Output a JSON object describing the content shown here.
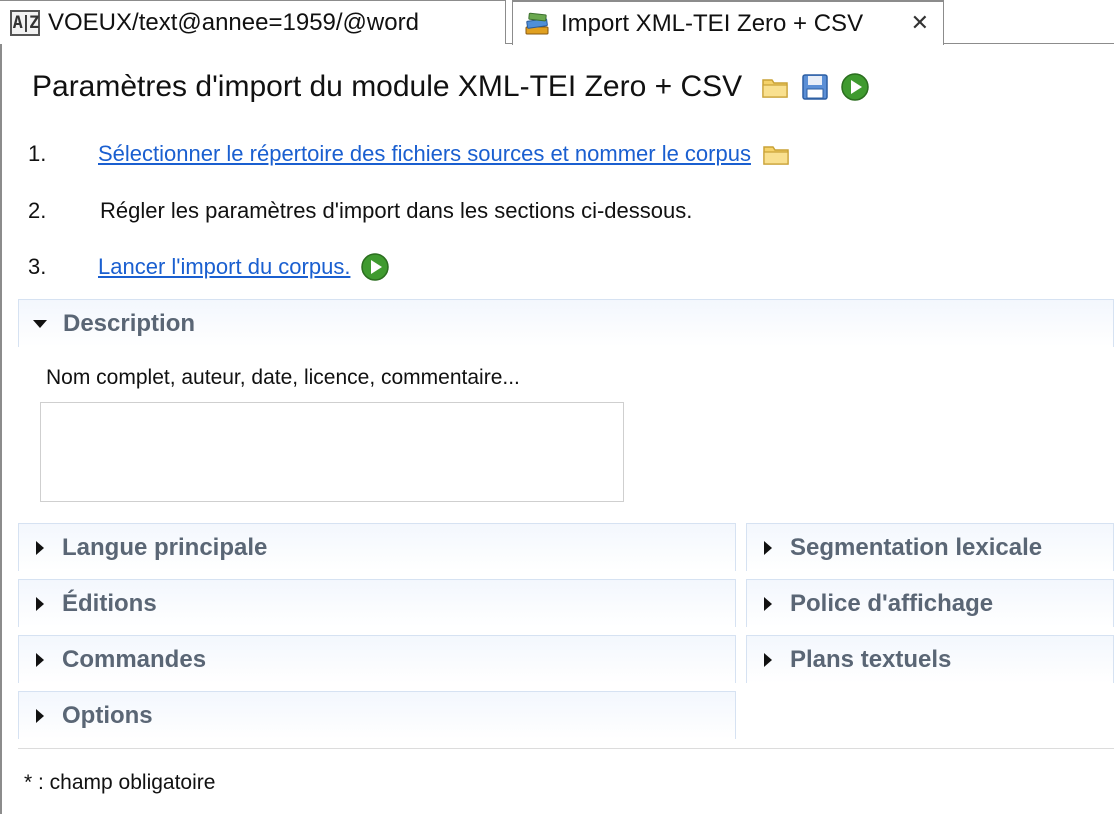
{
  "tabs": [
    {
      "label": "VOEUX/text@annee=1959/@word",
      "icon": "az-index-icon",
      "icon_text": "A|Z"
    },
    {
      "label": "Import XML-TEI Zero + CSV",
      "icon": "books-icon",
      "close": "✕"
    }
  ],
  "header": {
    "title": "Paramètres d'import du module XML-TEI Zero + CSV",
    "icons": [
      "folder-icon",
      "save-icon",
      "run-icon"
    ]
  },
  "steps": [
    {
      "num": "1.",
      "text": "Sélectionner le répertoire des fichiers sources et nommer le corpus",
      "link": true,
      "icon": "folder-icon"
    },
    {
      "num": "2.",
      "text": "Régler les paramètres d'import dans les sections ci-dessous.",
      "link": false
    },
    {
      "num": "3.",
      "text": "Lancer l'import du corpus.",
      "link": true,
      "icon": "run-icon"
    }
  ],
  "description": {
    "title": "Description",
    "expanded": true,
    "field_label": "Nom complet, auteur, date, licence, commentaire...",
    "value": ""
  },
  "sections_left": [
    "Langue principale",
    "Éditions",
    "Commandes",
    "Options"
  ],
  "sections_right": [
    "Segmentation lexicale",
    "Police d'affichage",
    "Plans textuels"
  ],
  "footer": {
    "note": "* : champ obligatoire"
  },
  "colors": {
    "link": "#1a5fd0",
    "section_text": "#5a6675",
    "section_border": "#d6e2f2"
  }
}
